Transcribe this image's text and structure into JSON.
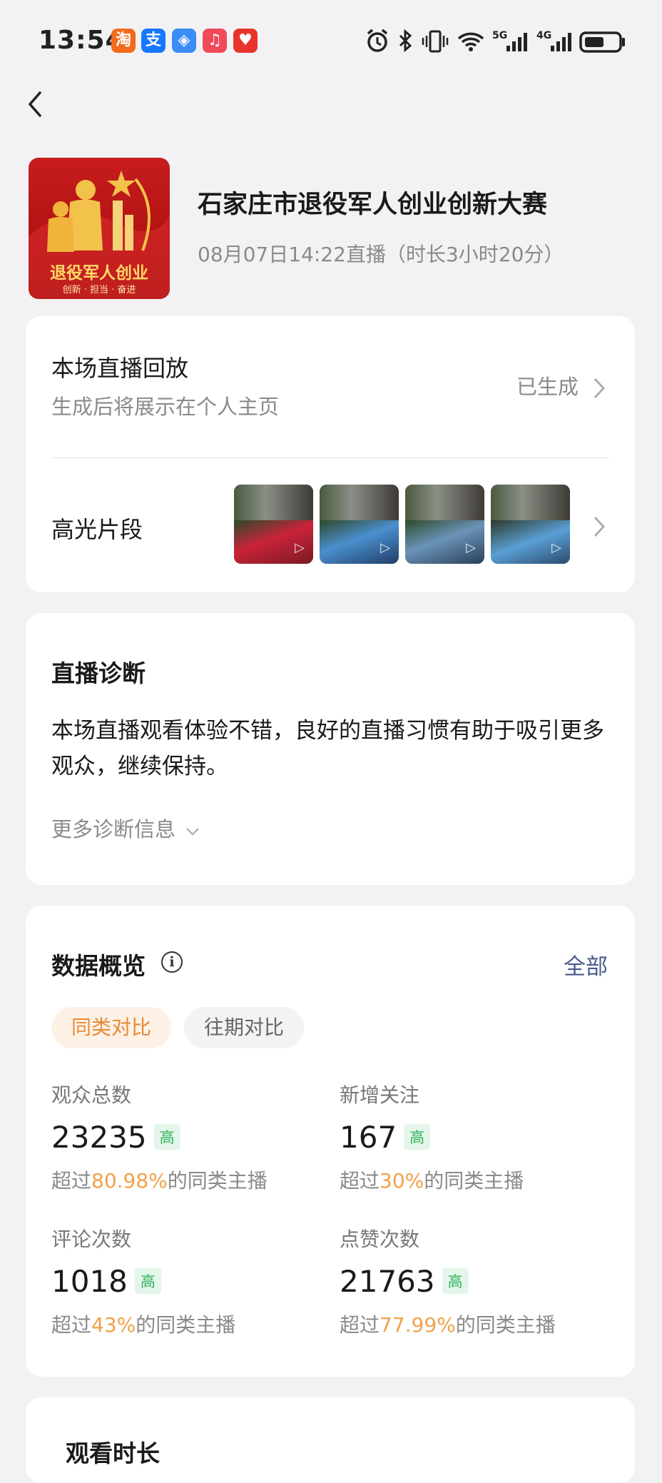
{
  "status_bar": {
    "time": "13:54",
    "apps": [
      {
        "icon": "taobao-icon",
        "glyph": "淘",
        "color": "#f26b1d"
      },
      {
        "icon": "alipay-icon",
        "glyph": "支",
        "color": "#1677ff"
      },
      {
        "icon": "shield-app-icon",
        "glyph": "◈",
        "color": "#3b8df5"
      },
      {
        "icon": "music-icon",
        "glyph": "♫",
        "color": "#f04a5a"
      },
      {
        "icon": "heart-app-icon",
        "glyph": "♥",
        "color": "#e8352b"
      }
    ]
  },
  "header": {
    "title": "石家庄市退役军人创业创新大赛",
    "meta": "08月07日14:22直播（时长3小时20分）",
    "cover_title": "退役军人创业",
    "cover_sub": "创新 · 担当 · 奋进"
  },
  "replay": {
    "title": "本场直播回放",
    "subtitle": "生成后将展示在个人主页",
    "status": "已生成"
  },
  "highlights": {
    "title": "高光片段",
    "thumbs": [
      {
        "accent": "#c9233a"
      },
      {
        "accent": "#4a8fcf"
      },
      {
        "accent": "#6a93b8"
      },
      {
        "accent": "#5a9fd6"
      }
    ]
  },
  "diagnosis": {
    "title": "直播诊断",
    "text": "本场直播观看体验不错，良好的直播习惯有助于吸引更多观众，继续保持。",
    "more": "更多诊断信息"
  },
  "overview": {
    "title": "数据概览",
    "all_link": "全部",
    "tabs": [
      "同类对比",
      "往期对比"
    ],
    "stats": [
      {
        "label": "观众总数",
        "value": "23235",
        "tag": "高",
        "prefix": "超过",
        "pct": "80.98%",
        "suffix": "的同类主播"
      },
      {
        "label": "新增关注",
        "value": "167",
        "tag": "高",
        "prefix": "超过",
        "pct": "30%",
        "suffix": "的同类主播"
      },
      {
        "label": "评论次数",
        "value": "1018",
        "tag": "高",
        "prefix": "超过",
        "pct": "43%",
        "suffix": "的同类主播"
      },
      {
        "label": "点赞次数",
        "value": "21763",
        "tag": "高",
        "prefix": "超过",
        "pct": "77.99%",
        "suffix": "的同类主播"
      }
    ]
  },
  "watch": {
    "title": "观看时长"
  }
}
